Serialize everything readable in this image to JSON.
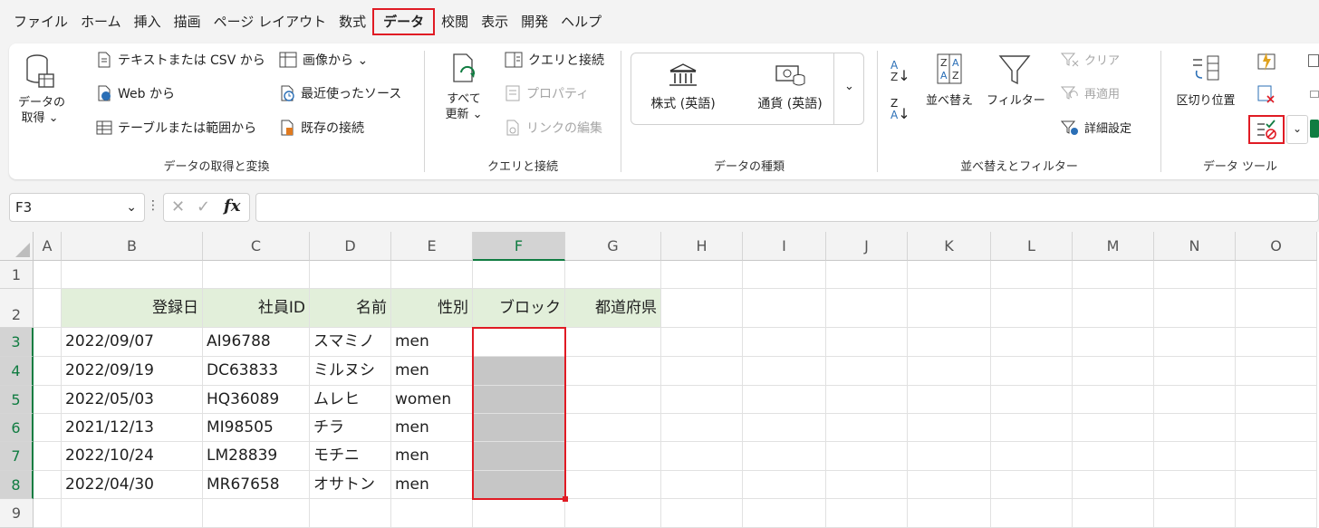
{
  "menu": {
    "tabs": [
      "ファイル",
      "ホーム",
      "挿入",
      "描画",
      "ページ レイアウト",
      "数式",
      "データ",
      "校閲",
      "表示",
      "開発",
      "ヘルプ"
    ],
    "active_index": 6
  },
  "ribbon": {
    "get_data": {
      "big_label_1": "データの",
      "big_label_2": "取得 ⌄",
      "text_csv": "テキストまたは CSV から",
      "web": "Web から",
      "table_range": "テーブルまたは範囲から",
      "from_picture": "画像から ⌄",
      "recent_sources": "最近使ったソース",
      "existing_connections": "既存の接続",
      "group_label": "データの取得と変換"
    },
    "queries": {
      "refresh_1": "すべて",
      "refresh_2": "更新 ⌄",
      "queries_connections": "クエリと接続",
      "properties": "プロパティ",
      "edit_links": "リンクの編集",
      "group_label": "クエリと接続"
    },
    "data_types": {
      "stocks": "株式 (英語)",
      "currencies": "通貨 (英語)",
      "group_label": "データの種類"
    },
    "sort_filter": {
      "sort": "並べ替え",
      "filter": "フィルター",
      "clear": "クリア",
      "reapply": "再適用",
      "advanced": "詳細設定",
      "group_label": "並べ替えとフィルター"
    },
    "data_tools": {
      "text_to_columns": "区切り位置",
      "group_label": "データ ツール"
    }
  },
  "formula_bar": {
    "name_box": "F3",
    "formula": ""
  },
  "sheet": {
    "columns": [
      "A",
      "B",
      "C",
      "D",
      "E",
      "F",
      "G",
      "H",
      "I",
      "J",
      "K",
      "L",
      "M",
      "N",
      "O"
    ],
    "rows": [
      "1",
      "2",
      "3",
      "4",
      "5",
      "6",
      "7",
      "8",
      "9"
    ],
    "headers": [
      "登録日",
      "社員ID",
      "名前",
      "性別",
      "ブロック",
      "都道府県"
    ],
    "data": [
      [
        "2022/09/07",
        "AI96788",
        "スマミノ",
        "men"
      ],
      [
        "2022/09/19",
        "DC63833",
        "ミルヌシ",
        "men"
      ],
      [
        "2022/05/03",
        "HQ36089",
        "ムレヒ",
        "women"
      ],
      [
        "2021/12/13",
        "MI98505",
        "チラ",
        "men"
      ],
      [
        "2022/10/24",
        "LM28839",
        "モチニ",
        "men"
      ],
      [
        "2022/04/30",
        "MR67658",
        "オサトン",
        "men"
      ]
    ]
  },
  "colors": {
    "highlight": "#e01b24",
    "header_fill": "#e2efda",
    "selection_fill": "#c6c6c6",
    "excel_green": "#107c41"
  }
}
